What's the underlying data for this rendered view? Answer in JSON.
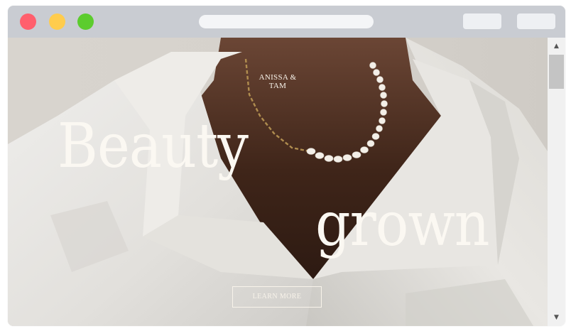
{
  "window": {
    "controls": [
      "close",
      "minimize",
      "maximize"
    ],
    "address_bar_value": "",
    "toolbar_buttons": [
      "",
      ""
    ]
  },
  "hero": {
    "brand": "ANISSA & TAM",
    "headline_1": "Beauty",
    "headline_2": "grown",
    "cta_label": "LEARN MORE"
  },
  "scrollbar": {
    "up_icon": "▲",
    "down_icon": "▼"
  },
  "colors": {
    "titlebar": "#c9ccd2",
    "close": "#ff5f6d",
    "minimize": "#ffcc4d",
    "maximize": "#5ccc2e",
    "hero_text": "#fbf8f2"
  }
}
